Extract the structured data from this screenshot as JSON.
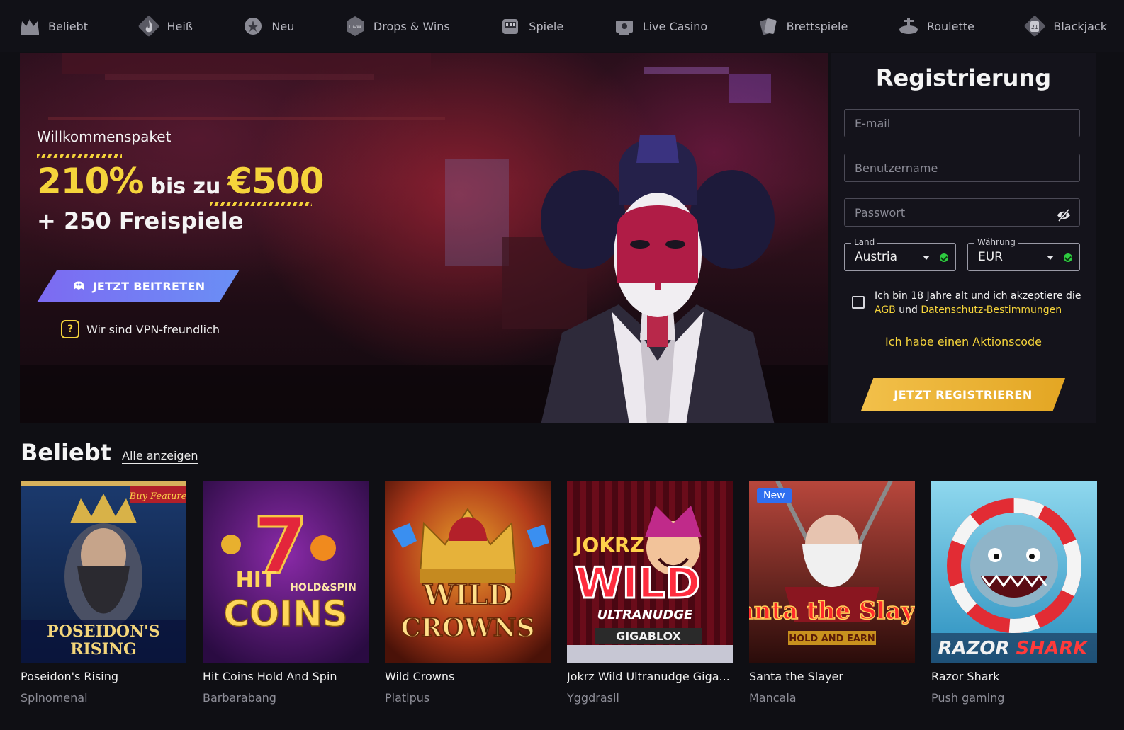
{
  "nav": {
    "items": [
      {
        "label": "Beliebt",
        "icon": "crown-icon"
      },
      {
        "label": "Heiß",
        "icon": "flame-icon"
      },
      {
        "label": "Neu",
        "icon": "new-icon"
      },
      {
        "label": "Drops & Wins",
        "icon": "drops-wins-icon"
      },
      {
        "label": "Spiele",
        "icon": "slot-machine-icon"
      },
      {
        "label": "Live Casino",
        "icon": "live-casino-icon"
      },
      {
        "label": "Brettspiele",
        "icon": "cards-icon"
      },
      {
        "label": "Roulette",
        "icon": "roulette-icon"
      },
      {
        "label": "Blackjack",
        "icon": "blackjack-icon"
      }
    ]
  },
  "hero": {
    "pre": "Willkommenspaket",
    "percent": "210%",
    "upto": "bis zu",
    "amount": "€500",
    "freespins": "+ 250 Freispiele",
    "join_button": "JETZT BEITRETEN",
    "vpn_text": "Wir sind VPN-freundlich"
  },
  "registration": {
    "title": "Registrierung",
    "email_placeholder": "E-mail",
    "username_placeholder": "Benutzername",
    "password_placeholder": "Passwort",
    "country_label": "Land",
    "country_value": "Austria",
    "currency_label": "Währung",
    "currency_value": "EUR",
    "terms_text": "Ich bin 18 Jahre alt und ich akzeptiere die",
    "terms_link1": "AGB",
    "terms_and": "und",
    "terms_link2": "Datenschutz-Bestimmungen",
    "promo_link": "Ich habe einen Aktionscode",
    "register_button": "JETZT REGISTRIEREN"
  },
  "popular": {
    "title": "Beliebt",
    "see_all": "Alle anzeigen",
    "games": [
      {
        "name": "Poseidon's Rising",
        "provider": "Spinomenal",
        "art_title": "POSEIDON'S RISING",
        "art_tag": "Buy Feature"
      },
      {
        "name": "Hit Coins Hold And Spin",
        "provider": "Barbarabang",
        "art_title": "HIT COINS",
        "art_tag": "HOLD & SPIN"
      },
      {
        "name": "Wild Crowns",
        "provider": "Platipus",
        "art_title": "WILD CROWNS"
      },
      {
        "name": "Jokrz Wild Ultranudge Giga...",
        "provider": "Yggdrasil",
        "art_title": "JOKRZ WILD",
        "art_tag": "ULTRANUDGE"
      },
      {
        "name": "Santa the Slayer",
        "provider": "Mancala",
        "badge": "New",
        "art_title": "Santa the Slayer",
        "art_tag": "HOLD AND EARN"
      },
      {
        "name": "Razor Shark",
        "provider": "Push gaming",
        "art_title": "RAZOR SHARK"
      }
    ]
  },
  "colors": {
    "accent_yellow": "#f5d43b",
    "join_purple": "#7d6af2",
    "register_gold": "#e3a623",
    "new_badge": "#2f6ff0"
  }
}
